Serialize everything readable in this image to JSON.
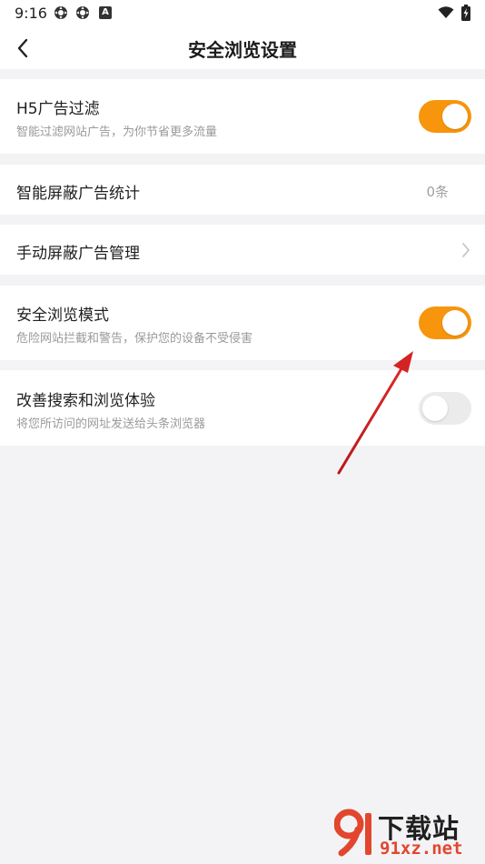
{
  "status_bar": {
    "time": "9:16",
    "icons": [
      "settings-gear-icon",
      "settings-gear-icon",
      "a-app-icon",
      "wifi-icon",
      "battery-charging-icon"
    ]
  },
  "header": {
    "back_icon": "chevron-left-icon",
    "title": "安全浏览设置"
  },
  "settings": {
    "h5_filter": {
      "title": "H5广告过滤",
      "subtitle": "智能过滤网站广告，为你节省更多流量",
      "enabled": true
    },
    "smart_block_stats": {
      "title": "智能屏蔽广告统计",
      "value": "0条"
    },
    "manual_block": {
      "title": "手动屏蔽广告管理",
      "icon": "chevron-right-icon"
    },
    "safe_mode": {
      "title": "安全浏览模式",
      "subtitle": "危险网站拦截和警告，保护您的设备不受侵害",
      "enabled": true
    },
    "improve_search": {
      "title": "改善搜索和浏览体验",
      "subtitle": "将您所访问的网址发送给头条浏览器",
      "enabled": false
    }
  },
  "colors": {
    "accent": "#f7950c",
    "toggle_off": "#ebebeb",
    "background": "#f3f3f5",
    "annotation_arrow": "#d42323"
  },
  "watermark": {
    "logo_text": "91",
    "top_text": "下载站",
    "bottom_text": "91xz.net"
  }
}
